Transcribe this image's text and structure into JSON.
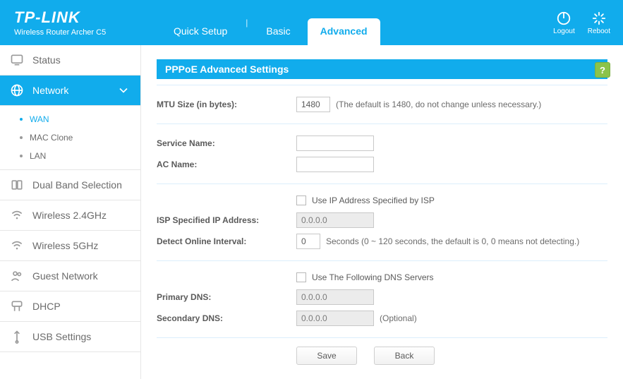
{
  "header": {
    "brand": "TP-LINK",
    "model": "Wireless Router Archer C5",
    "tabs": {
      "quick": "Quick Setup",
      "basic": "Basic",
      "advanced": "Advanced"
    },
    "logout": "Logout",
    "reboot": "Reboot"
  },
  "sidebar": {
    "status": "Status",
    "network": "Network",
    "sub": {
      "wan": "WAN",
      "mac": "MAC Clone",
      "lan": "LAN"
    },
    "dual": "Dual Band Selection",
    "w24": "Wireless 2.4GHz",
    "w5": "Wireless 5GHz",
    "guest": "Guest Network",
    "dhcp": "DHCP",
    "usb": "USB Settings"
  },
  "panel": {
    "title": "PPPoE Advanced Settings",
    "help": "?",
    "mtu_label": "MTU Size (in bytes):",
    "mtu_value": "1480",
    "mtu_hint": "(The default is 1480, do not change unless necessary.)",
    "service_label": "Service Name:",
    "service_value": "",
    "ac_label": "AC Name:",
    "ac_value": "",
    "use_isp_ip_label": "Use IP Address Specified by ISP",
    "isp_ip_label": "ISP Specified IP Address:",
    "isp_ip_value": "0.0.0.0",
    "detect_label": "Detect Online Interval:",
    "detect_value": "0",
    "detect_hint": "Seconds (0 ~ 120 seconds, the default is 0, 0 means not detecting.)",
    "use_dns_label": "Use The Following DNS Servers",
    "pdns_label": "Primary DNS:",
    "pdns_value": "0.0.0.0",
    "sdns_label": "Secondary DNS:",
    "sdns_value": "0.0.0.0",
    "optional": "(Optional)",
    "save": "Save",
    "back": "Back"
  }
}
